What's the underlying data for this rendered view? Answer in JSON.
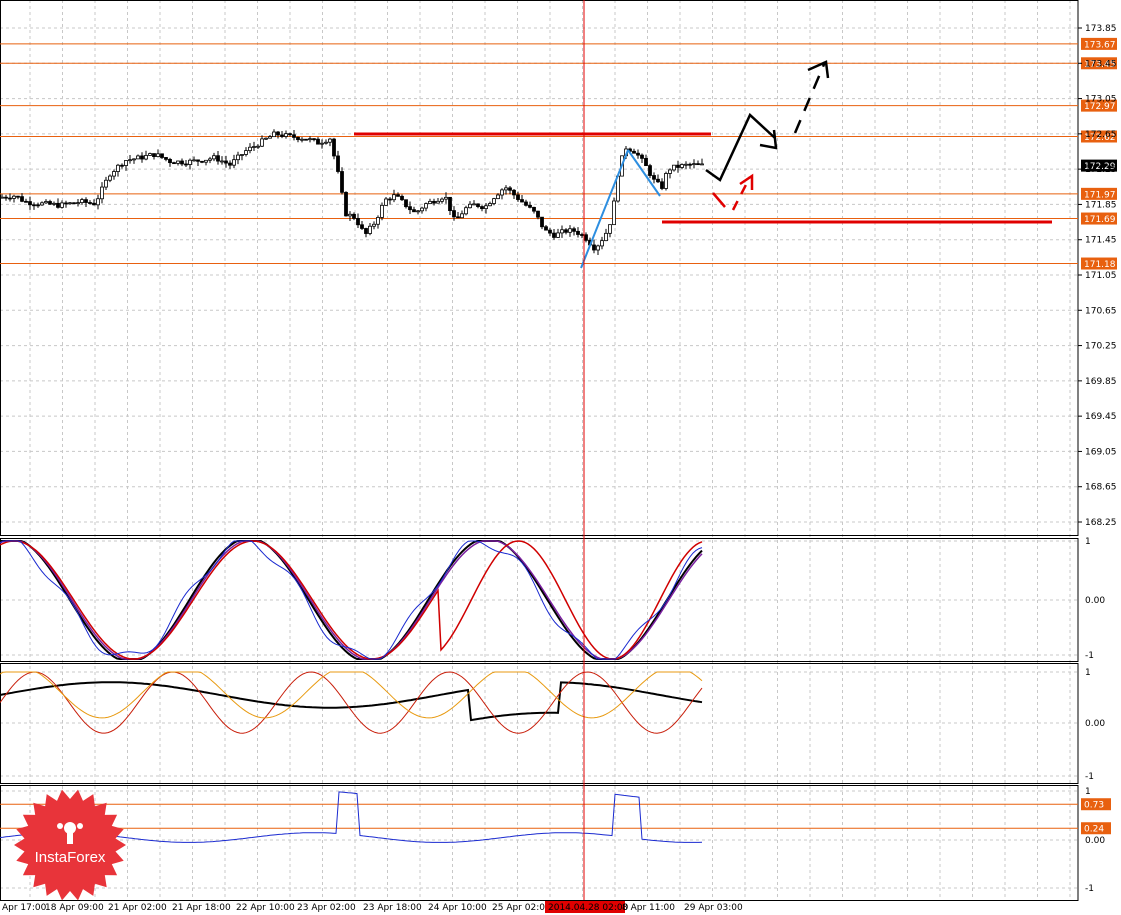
{
  "chart_data": [
    {
      "type": "candlestick",
      "title": "",
      "price_axis_ticks": [
        "173.85",
        "173.45",
        "173.05",
        "172.65",
        "172.25",
        "171.85",
        "171.45",
        "171.05",
        "170.65",
        "170.25",
        "169.85",
        "169.45",
        "169.05",
        "168.65",
        "168.25"
      ],
      "ylim": [
        168.2,
        174.0
      ],
      "current_price": "172.29",
      "level_lines": [
        {
          "label": "173.67",
          "value": 173.67,
          "color": "#e8600f"
        },
        {
          "label": "173.45",
          "value": 173.45,
          "color": "#e8600f"
        },
        {
          "label": "172.97",
          "value": 172.97,
          "color": "#e8600f"
        },
        {
          "label": "172.62",
          "value": 172.62,
          "color": "#e8600f"
        },
        {
          "label": "171.97",
          "value": 171.97,
          "color": "#e8600f"
        },
        {
          "label": "171.69",
          "value": 171.69,
          "color": "#e8600f"
        },
        {
          "label": "171.18",
          "value": 171.18,
          "color": "#e8600f"
        }
      ],
      "time_axis_labels": [
        "Apr 17:00",
        "18 Apr 09:00",
        "21 Apr 02:00",
        "21 Apr 18:00",
        "22 Apr 10:00",
        "23 Apr 02:00",
        "23 Apr 18:00",
        "24 Apr 10:00",
        "25 Apr 02:00",
        "2014.04.28 02:00",
        "8 Apr 11:00",
        "29 Apr 03:00"
      ],
      "highlighted_time": "2014.04.28 02:00",
      "close_path": [
        [
          0,
          171.93
        ],
        [
          15,
          171.95
        ],
        [
          25,
          171.88
        ],
        [
          40,
          171.86
        ],
        [
          60,
          171.84
        ],
        [
          80,
          171.88
        ],
        [
          95,
          171.86
        ],
        [
          110,
          172.2
        ],
        [
          125,
          172.35
        ],
        [
          140,
          172.38
        ],
        [
          155,
          172.42
        ],
        [
          170,
          172.34
        ],
        [
          185,
          172.33
        ],
        [
          200,
          172.35
        ],
        [
          215,
          172.38
        ],
        [
          230,
          172.3
        ],
        [
          245,
          172.45
        ],
        [
          260,
          172.55
        ],
        [
          275,
          172.65
        ],
        [
          290,
          172.62
        ],
        [
          305,
          172.6
        ],
        [
          318,
          172.55
        ],
        [
          330,
          172.6
        ],
        [
          340,
          172.1
        ],
        [
          345,
          171.75
        ],
        [
          355,
          171.7
        ],
        [
          365,
          171.5
        ],
        [
          375,
          171.65
        ],
        [
          385,
          171.9
        ],
        [
          395,
          171.95
        ],
        [
          405,
          171.85
        ],
        [
          415,
          171.75
        ],
        [
          425,
          171.85
        ],
        [
          435,
          171.9
        ],
        [
          445,
          171.95
        ],
        [
          455,
          171.65
        ],
        [
          465,
          171.8
        ],
        [
          475,
          171.85
        ],
        [
          485,
          171.82
        ],
        [
          495,
          171.95
        ],
        [
          505,
          172.05
        ],
        [
          515,
          171.95
        ],
        [
          525,
          171.85
        ],
        [
          535,
          171.75
        ],
        [
          545,
          171.55
        ],
        [
          555,
          171.5
        ],
        [
          565,
          171.55
        ],
        [
          575,
          171.55
        ],
        [
          585,
          171.48
        ],
        [
          595,
          171.35
        ],
        [
          605,
          171.5
        ],
        [
          612,
          171.7
        ],
        [
          618,
          172.2
        ],
        [
          625,
          172.5
        ],
        [
          635,
          172.45
        ],
        [
          645,
          172.3
        ],
        [
          655,
          172.1
        ],
        [
          662,
          172.05
        ],
        [
          668,
          172.25
        ],
        [
          678,
          172.28
        ],
        [
          690,
          172.3
        ],
        [
          705,
          172.29
        ]
      ]
    },
    {
      "type": "line",
      "title": "",
      "y_ticks": [
        "1",
        "0.00",
        "-1"
      ],
      "ylim": [
        -1.05,
        1.05
      ]
    },
    {
      "type": "line",
      "title": "",
      "y_ticks": [
        "1",
        "0.00",
        "-1"
      ],
      "ylim": [
        -1.05,
        1.05
      ]
    },
    {
      "type": "line",
      "title": "",
      "y_ticks": [
        "1",
        "0.00",
        "-1"
      ],
      "ylim": [
        -1.05,
        1.05
      ],
      "level_lines": [
        {
          "label": "0.73",
          "value": 0.73,
          "color": "#e8600f"
        },
        {
          "label": "0.24",
          "value": 0.24,
          "color": "#e8600f"
        }
      ]
    }
  ],
  "logo": {
    "text": "InstaForex",
    "color": "#e8343a"
  },
  "colors": {
    "level": "#e8600f",
    "signal_red": "#e00000",
    "vertical_marker": "#e00000",
    "grid": "#c8c8c8"
  }
}
